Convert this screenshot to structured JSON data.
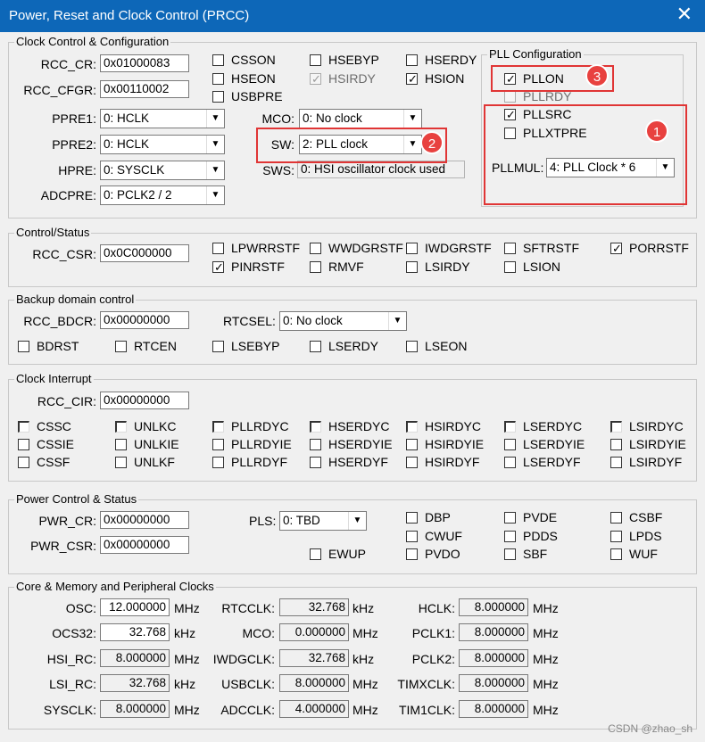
{
  "window": {
    "title": "Power, Reset and Clock Control (PRCC)",
    "close": "✕"
  },
  "clock_cfg": {
    "group": "Clock Control & Configuration",
    "rcc_cr_label": "RCC_CR:",
    "rcc_cr": "0x01000083",
    "rcc_cfgr_label": "RCC_CFGR:",
    "rcc_cfgr": "0x00110002",
    "ppre1_label": "PPRE1:",
    "ppre1": "0: HCLK",
    "ppre2_label": "PPRE2:",
    "ppre2": "0: HCLK",
    "hpre_label": "HPRE:",
    "hpre": "0: SYSCLK",
    "adcpre_label": "ADCPRE:",
    "adcpre": "0: PCLK2 / 2",
    "mco_label": "MCO:",
    "mco": "0: No clock",
    "sw_label": "SW:",
    "sw": "2: PLL clock",
    "sws_label": "SWS:",
    "sws": "0: HSI oscillator clock used",
    "css_on": "CSSON",
    "hse_byp": "HSEBYP",
    "hse_rdy": "HSERDY",
    "hse_on": "HSEON",
    "hsi_rdy": "HSIRDY",
    "hsi_on": "HSION",
    "usb_pre": "USBPRE"
  },
  "pll": {
    "group": "PLL Configuration",
    "pllon": "PLLON",
    "pllrdy": "PLLRDY",
    "pllsrc": "PLLSRC",
    "pllxtpre": "PLLXTPRE",
    "pllmul_label": "PLLMUL:",
    "pllmul": "4: PLL Clock * 6"
  },
  "badges": {
    "b1": "1",
    "b2": "2",
    "b3": "3"
  },
  "ctrl_status": {
    "group": "Control/Status",
    "csr_label": "RCC_CSR:",
    "csr": "0x0C000000",
    "flags": [
      "LPWRRSTF",
      "WWDGRSTF",
      "IWDGRSTF",
      "SFTRSTF",
      "PORRSTF",
      "PINRSTF",
      "RMVF",
      "LSIRDY",
      "LSION"
    ]
  },
  "backup": {
    "group": "Backup domain control",
    "bdcr_label": "RCC_BDCR:",
    "bdcr": "0x00000000",
    "rtcsel_label": "RTCSEL:",
    "rtcsel": "0: No clock",
    "flags": [
      "BDRST",
      "RTCEN",
      "LSEBYP",
      "LSERDY",
      "LSEON"
    ]
  },
  "interrupt": {
    "group": "Clock Interrupt",
    "cir_label": "RCC_CIR:",
    "cir": "0x00000000",
    "flags": [
      "CSSC",
      "UNLKC",
      "PLLRDYC",
      "HSERDYC",
      "HSIRDYC",
      "LSERDYC",
      "LSIRDYC",
      "CSSIE",
      "UNLKIE",
      "PLLRDYIE",
      "HSERDYIE",
      "HSIRDYIE",
      "LSERDYIE",
      "LSIRDYIE",
      "CSSF",
      "UNLKF",
      "PLLRDYF",
      "HSERDYF",
      "HSIRDYF",
      "LSERDYF",
      "LSIRDYF"
    ]
  },
  "power": {
    "group": "Power Control & Status",
    "pwr_cr_label": "PWR_CR:",
    "pwr_cr": "0x00000000",
    "pwr_csr_label": "PWR_CSR:",
    "pwr_csr": "0x00000000",
    "pls_label": "PLS:",
    "pls": "0: TBD",
    "flags": [
      "DBP",
      "PVDE",
      "CSBF",
      "CWUF",
      "PDDS",
      "LPDS",
      "EWUP",
      "PVDO",
      "SBF",
      "WUF"
    ]
  },
  "clocks": {
    "group": "Core & Memory and Peripheral Clocks",
    "osc_label": "OSC:",
    "osc": "12.000000",
    "osc_unit": "MHz",
    "ocs32_label": "OCS32:",
    "ocs32": "32.768",
    "ocs32_unit": "kHz",
    "hsirc_label": "HSI_RC:",
    "hsirc": "8.000000",
    "hsirc_unit": "MHz",
    "lsirc_label": "LSI_RC:",
    "lsirc": "32.768",
    "lsirc_unit": "kHz",
    "sysclk_label": "SYSCLK:",
    "sysclk": "8.000000",
    "sysclk_unit": "MHz",
    "rtcclk_label": "RTCCLK:",
    "rtcclk": "32.768",
    "rtcclk_unit": "kHz",
    "mcoclk_label": "MCO:",
    "mcoclk": "0.000000",
    "mcoclk_unit": "MHz",
    "iwdg_label": "IWDGCLK:",
    "iwdg": "32.768",
    "iwdg_unit": "kHz",
    "usb_label": "USBCLK:",
    "usb": "8.000000",
    "usb_unit": "MHz",
    "adc_label": "ADCCLK:",
    "adc": "4.000000",
    "adc_unit": "MHz",
    "hclk_label": "HCLK:",
    "hclk": "8.000000",
    "hclk_unit": "MHz",
    "pclk1_label": "PCLK1:",
    "pclk1": "8.000000",
    "pclk1_unit": "MHz",
    "pclk2_label": "PCLK2:",
    "pclk2": "8.000000",
    "pclk2_unit": "MHz",
    "timx_label": "TIMXCLK:",
    "timx": "8.000000",
    "timx_unit": "MHz",
    "tim1_label": "TIM1CLK:",
    "tim1": "8.000000",
    "tim1_unit": "MHz"
  },
  "checkmark": "✓",
  "dropdown_arrow": "▼",
  "watermark": "CSDN @zhao_sh"
}
